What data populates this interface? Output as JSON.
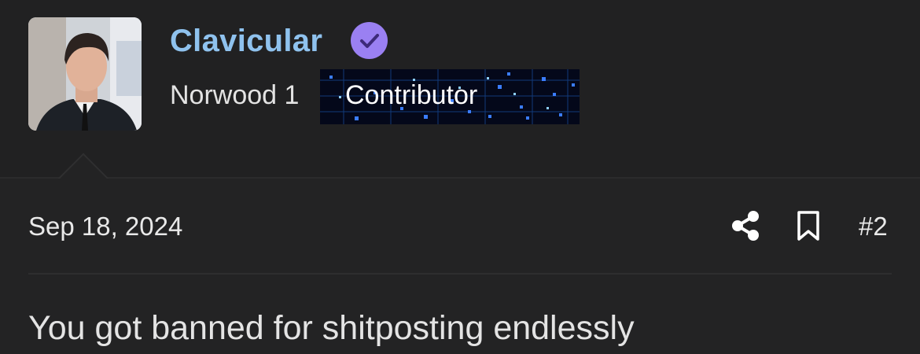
{
  "author": {
    "name": "Clavicular",
    "verified_icon": "verified-check-icon",
    "tier": "Norwood 1",
    "badge": "Contributor",
    "name_color": "#8fc2ee",
    "verified_color": "#9a80f2"
  },
  "post": {
    "date": "Sep 18, 2024",
    "number": "#2",
    "message": "You got banned for shitposting endlessly"
  },
  "actions": {
    "share_icon": "share-icon",
    "bookmark_icon": "bookmark-icon"
  }
}
